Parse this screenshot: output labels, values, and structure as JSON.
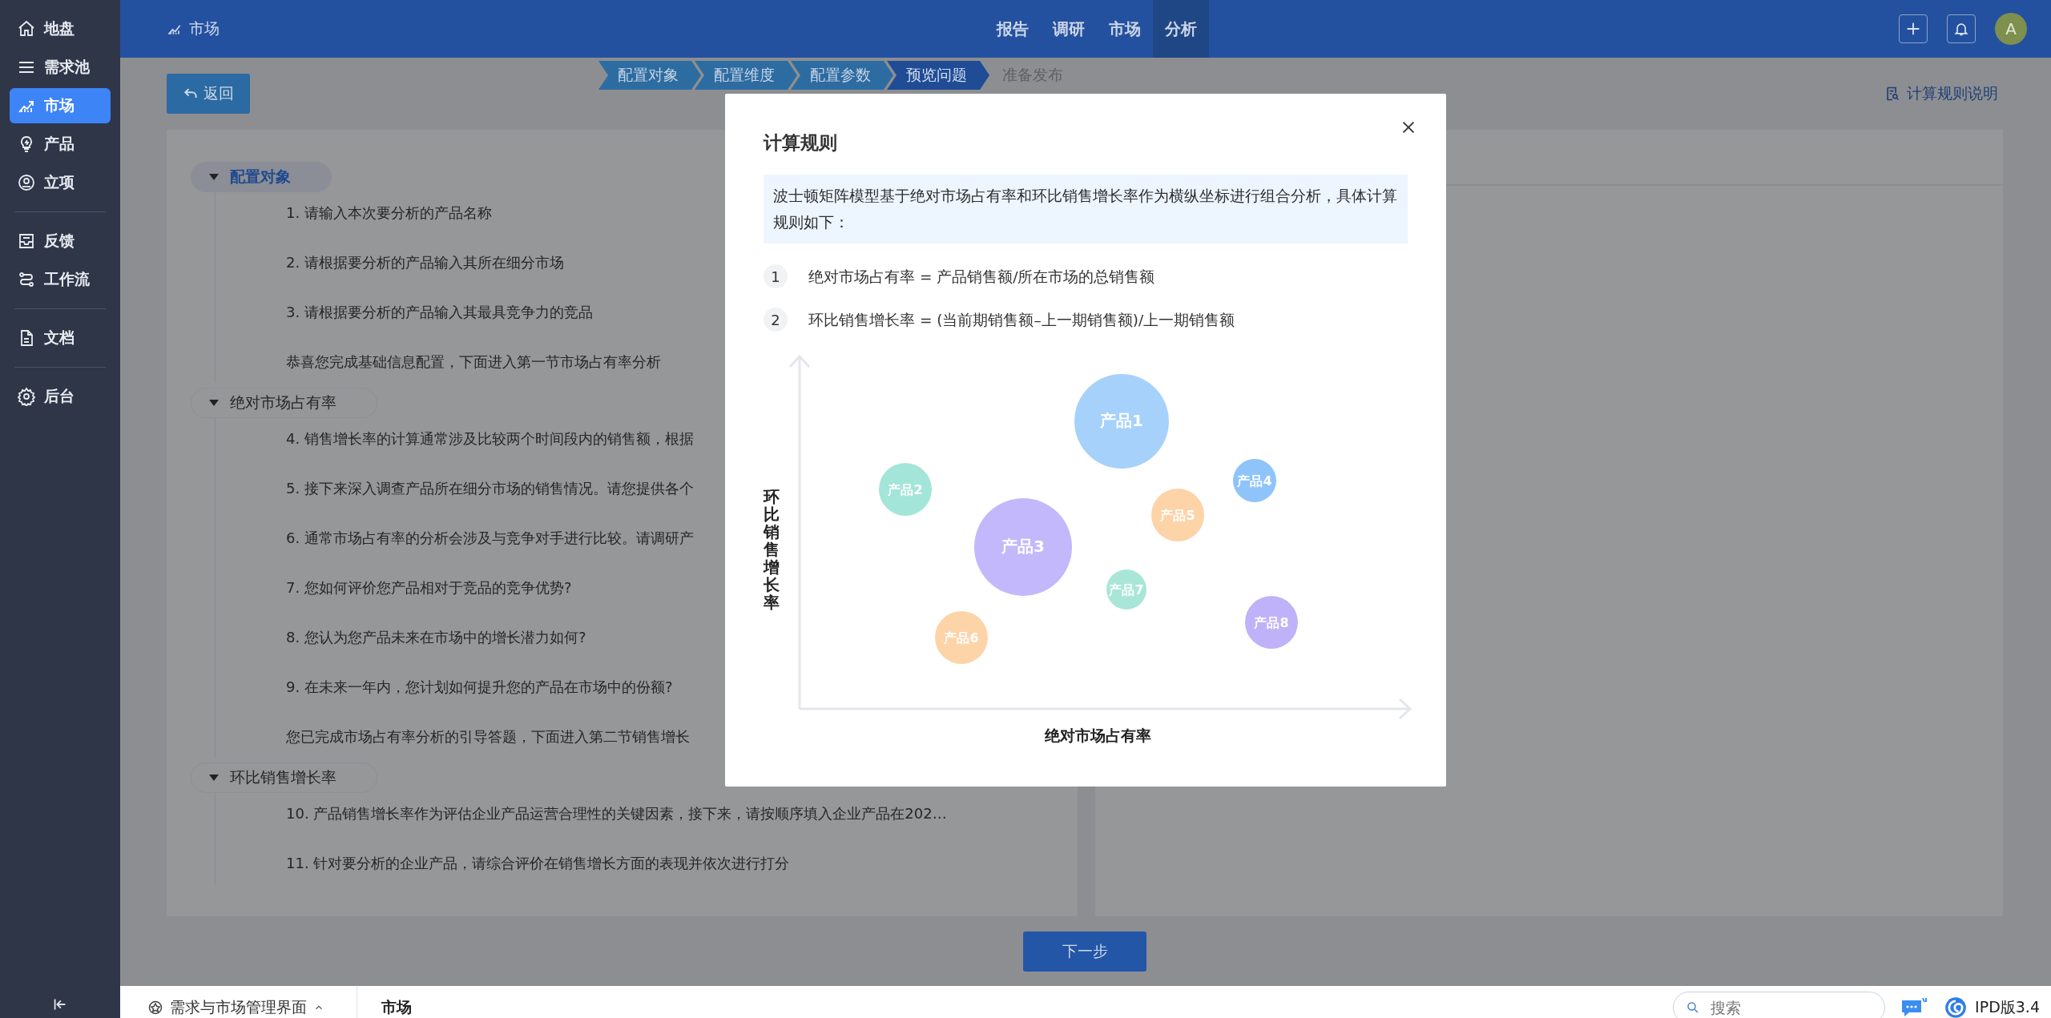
{
  "sidebar": {
    "items": [
      {
        "label": "地盘",
        "selected": false,
        "divider_after": false
      },
      {
        "label": "需求池",
        "selected": false,
        "divider_after": false
      },
      {
        "label": "市场",
        "selected": true,
        "divider_after": false
      },
      {
        "label": "产品",
        "selected": false,
        "divider_after": false
      },
      {
        "label": "立项",
        "selected": false,
        "divider_after": true
      },
      {
        "label": "反馈",
        "selected": false,
        "divider_after": false
      },
      {
        "label": "工作流",
        "selected": false,
        "divider_after": true
      },
      {
        "label": "文档",
        "selected": false,
        "divider_after": true
      },
      {
        "label": "后台",
        "selected": false,
        "divider_after": false
      }
    ]
  },
  "header": {
    "title": "市场",
    "tabs": [
      {
        "label": "报告",
        "selected": false
      },
      {
        "label": "调研",
        "selected": false
      },
      {
        "label": "市场",
        "selected": false
      },
      {
        "label": "分析",
        "selected": true
      }
    ],
    "avatar": "A"
  },
  "toolbar": {
    "back": "返回",
    "steps": [
      {
        "label": "配置对象",
        "done": true,
        "selected": false
      },
      {
        "label": "配置维度",
        "done": true,
        "selected": false
      },
      {
        "label": "配置参数",
        "done": true,
        "selected": false
      },
      {
        "label": "预览问题",
        "done": false,
        "selected": true
      },
      {
        "label": "准备发布",
        "done": false,
        "selected": false
      }
    ],
    "help_link": "计算规则说明"
  },
  "outline": [
    {
      "title": "配置对象",
      "selected": true,
      "items": [
        "1. 请输入本次要分析的产品名称",
        "2. 请根据要分析的产品输入其所在细分市场",
        "3. 请根据要分析的产品输入其最具竞争力的竞品",
        "恭喜您完成基础信息配置，下面进入第一节市场占有率分析"
      ]
    },
    {
      "title": "绝对市场占有率",
      "selected": false,
      "items": [
        "4. 销售增长率的计算通常涉及比较两个时间段内的销售额，根据",
        "5. 接下来深入调查产品所在细分市场的销售情况。请您提供各个",
        "6. 通常市场占有率的分析会涉及与竞争对手进行比较。请调研产",
        "7. 您如何评价您产品相对于竞品的竞争优势?",
        "8. 您认为您产品未来在市场中的增长潜力如何?",
        "9. 在未来一年内，您计划如何提升您的产品在市场中的份额?",
        "您已完成市场占有率分析的引导答题，下面进入第二节销售增长"
      ]
    },
    {
      "title": "环比销售增长率",
      "selected": false,
      "items": [
        "10. 产品销售增长率作为评估企业产品运营合理性的关键因素，接下来，请按顺序填入企业产品在202…",
        "11. 针对要分析的企业产品，请综合评价在销售增长方面的表现并依次进行打分"
      ]
    }
  ],
  "next_button": "下一步",
  "modal": {
    "title": "计算规则",
    "intro": "波士顿矩阵模型基于绝对市场占有率和环比销售增长率作为横纵坐标进行组合分析，具体计算规则如下：",
    "rules": [
      {
        "number": "1",
        "text": "绝对市场占有率 = 产品销售额/所在市场的总销售额"
      },
      {
        "number": "2",
        "text": "环比销售增长率 = (当前期销售额–上一期销售额)/上一期销售额"
      }
    ],
    "chart": {
      "ylabel": "环比销售增长率",
      "xlabel": "绝对市场占有率",
      "bubbles": [
        {
          "label": "产品1",
          "color": "#a6d1fb"
        },
        {
          "label": "产品2",
          "color": "#a3e6d9"
        },
        {
          "label": "产品3",
          "color": "#c3b8fb"
        },
        {
          "label": "产品4",
          "color": "#8ec4fa"
        },
        {
          "label": "产品5",
          "color": "#fdd3a8"
        },
        {
          "label": "产品6",
          "color": "#fdd3a8"
        },
        {
          "label": "产品7",
          "color": "#a8e6d8"
        },
        {
          "label": "产品8",
          "color": "#c0b2f8"
        }
      ]
    }
  },
  "status_bar": {
    "breadcrumb": "需求与市场管理界面",
    "current": "市场",
    "search_placeholder": "搜索",
    "version": "IPD版3.4"
  }
}
